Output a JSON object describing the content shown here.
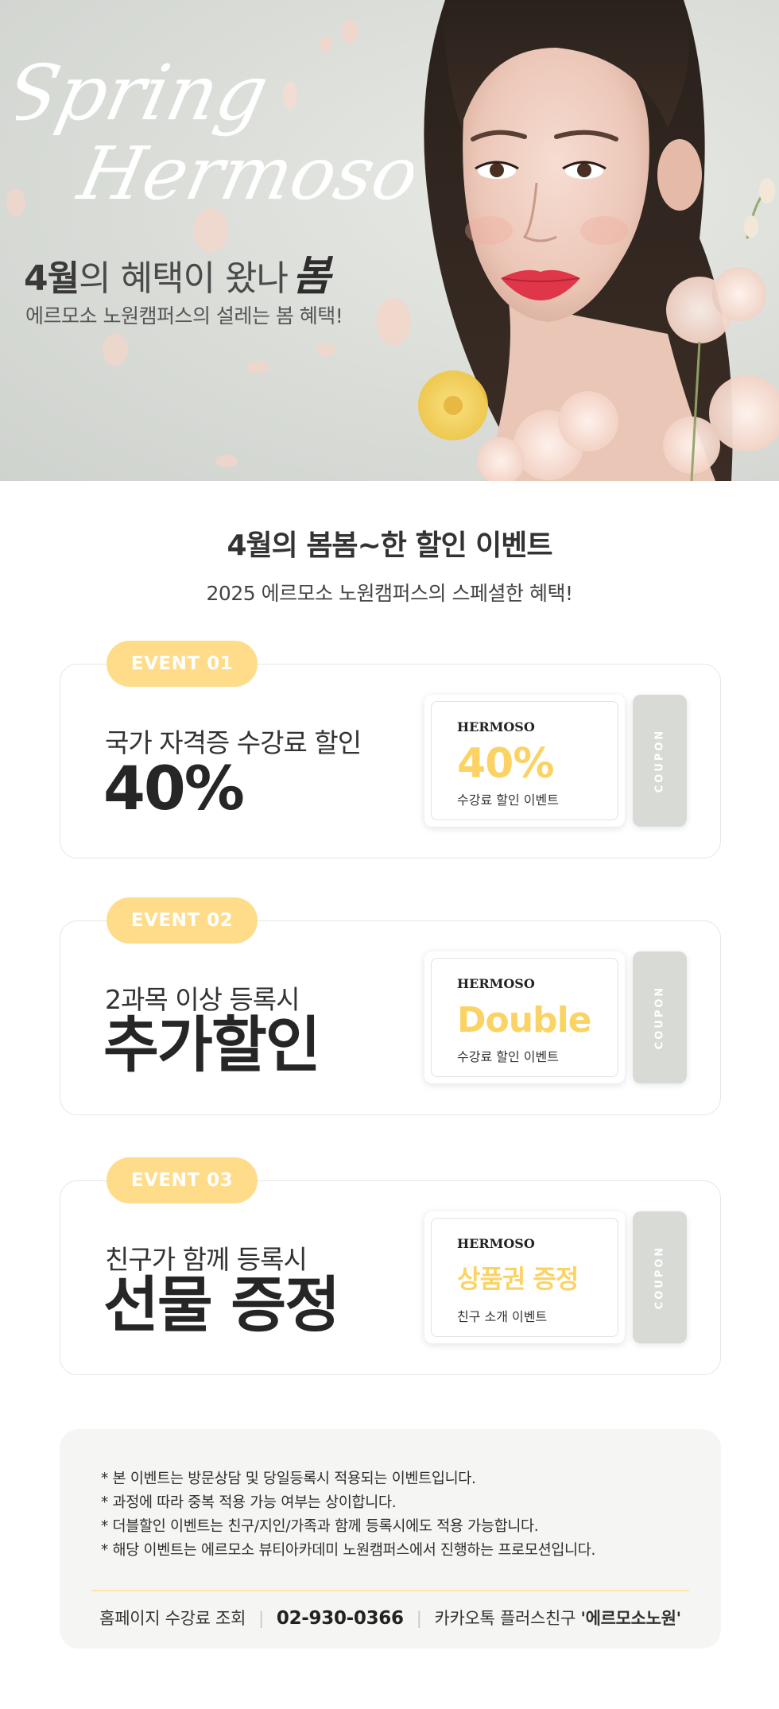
{
  "hero": {
    "script_line1": "Spring",
    "script_line2": "Hermoso",
    "heading_bold": "4월",
    "heading_rest": "의 혜택이 왔나",
    "heading_bom": "봄",
    "subheading": "에르모소 노원캠퍼스의 설레는 봄 혜택!"
  },
  "intro": {
    "title_bold1": "4월",
    "title_part1": "의 ",
    "title_bold2": "봄봄",
    "title_part2": "~한 할인 이벤트",
    "subtitle": "2025 에르모소 노원캠퍼스의 스페셜한 혜택!"
  },
  "events": [
    {
      "badge": "EVENT 01",
      "subtitle": "국가 자격증 수강료 할인",
      "headline": "40%",
      "coupon": {
        "brand": "HERMOSO",
        "value": "40%",
        "desc": "수강료 할인 이벤트",
        "stub": "COUPON"
      }
    },
    {
      "badge": "EVENT 02",
      "subtitle": "2과목 이상 등록시",
      "headline": "추가할인",
      "coupon": {
        "brand": "HERMOSO",
        "value": "Double",
        "desc": "수강료 할인 이벤트",
        "stub": "COUPON"
      }
    },
    {
      "badge": "EVENT 03",
      "subtitle": "친구가 함께 등록시",
      "headline": "선물 증정",
      "coupon": {
        "brand": "HERMOSO",
        "value": "상품권 증정",
        "desc": "친구 소개 이벤트",
        "stub": "COUPON"
      }
    }
  ],
  "notes": {
    "items": [
      "* 본 이벤트는 방문상담 및 당일등록시 적용되는 이벤트입니다.",
      "* 과정에 따라 중복 적용 가능 여부는 상이합니다.",
      "* 더블할인 이벤트는 친구/지인/가족과 함께 등록시에도 적용 가능합니다.",
      "* 해당 이벤트는 에르모소 뷰티아카데미 노원캠퍼스에서 진행하는 프로모션입니다."
    ],
    "contact_label": "홈페이지 수강료 조회",
    "phone": "02-930-0366",
    "kakao_prefix": "카카오톡 플러스친구 ",
    "kakao_name": "'에르모소노원'",
    "separator": "|"
  },
  "colors": {
    "accent_yellow": "#fbd365",
    "pill_yellow": "#fedc8a",
    "stub_gray": "#d8dbd5",
    "hero_bg": "#d9dcd7"
  }
}
